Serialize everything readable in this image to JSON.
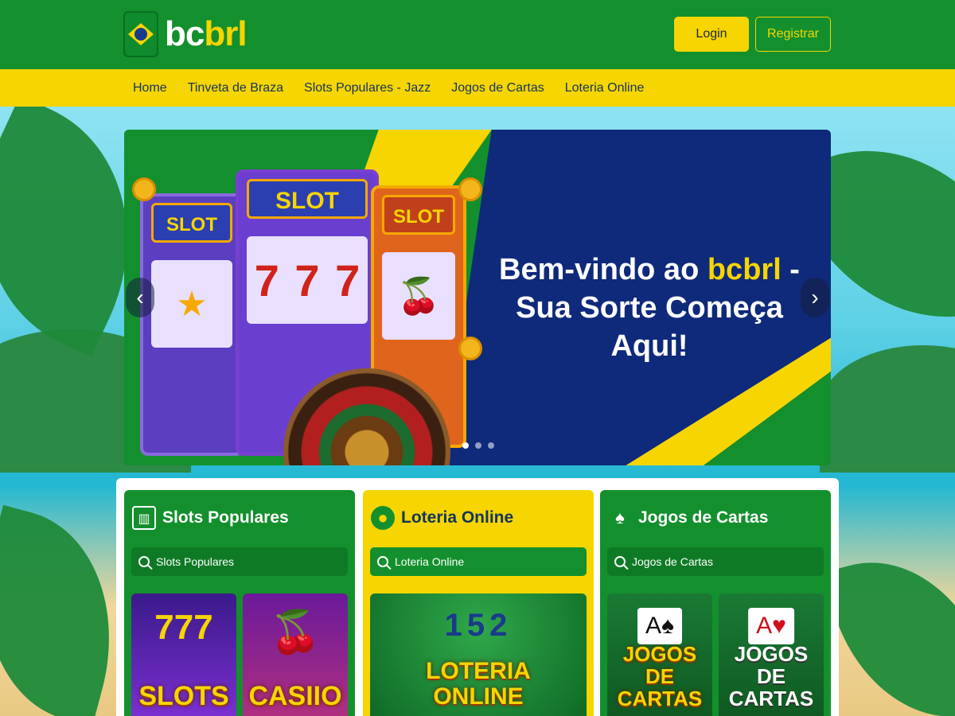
{
  "header": {
    "brand_white": "bc",
    "brand_yellow": "brl",
    "login_label": "Login",
    "register_label": "Registrar"
  },
  "nav": {
    "items": [
      "Home",
      "Tinveta de Braza",
      "Slots Populares - Jazz",
      "Jogos de Cartas",
      "Loteria Online"
    ]
  },
  "banner": {
    "headline_part1": "Bem-vindo ao ",
    "headline_brand": "bcbrl",
    "headline_part2": " -",
    "headline_line2": "Sua Sorte Começa Aqui!",
    "slot_sign": "SLOT",
    "reel_symbol": "7",
    "prev_arrow": "‹",
    "next_arrow": "›",
    "slide_count": 3,
    "active_slide": 1
  },
  "cards": [
    {
      "title": "Slots Populares",
      "icon": "slot-machine-icon",
      "search_placeholder": "Slots Populares",
      "thumbs": [
        {
          "label": "SLOTS",
          "art": "777"
        },
        {
          "label": "CASIIO",
          "art": "🍒"
        }
      ]
    },
    {
      "title": "Loteria Online",
      "icon": "lottery-ball-icon",
      "search_placeholder": "Loteria Online",
      "thumbs": [
        {
          "label": "LOTERIA ONLINE",
          "art": "152"
        }
      ]
    },
    {
      "title": "Jogos de Cartas",
      "icon": "playing-cards-icon",
      "search_placeholder": "Jogos de Cartas",
      "thumbs": [
        {
          "label": "JOGOS DE CARTAS",
          "art": "A♠"
        },
        {
          "label": "JOGOS DE CARTAS",
          "art": "A♥"
        }
      ]
    }
  ],
  "colors": {
    "brand_green": "#13902d",
    "brand_yellow": "#f6d500",
    "banner_blue": "#0f2a7a",
    "nav_text": "#12355e"
  }
}
